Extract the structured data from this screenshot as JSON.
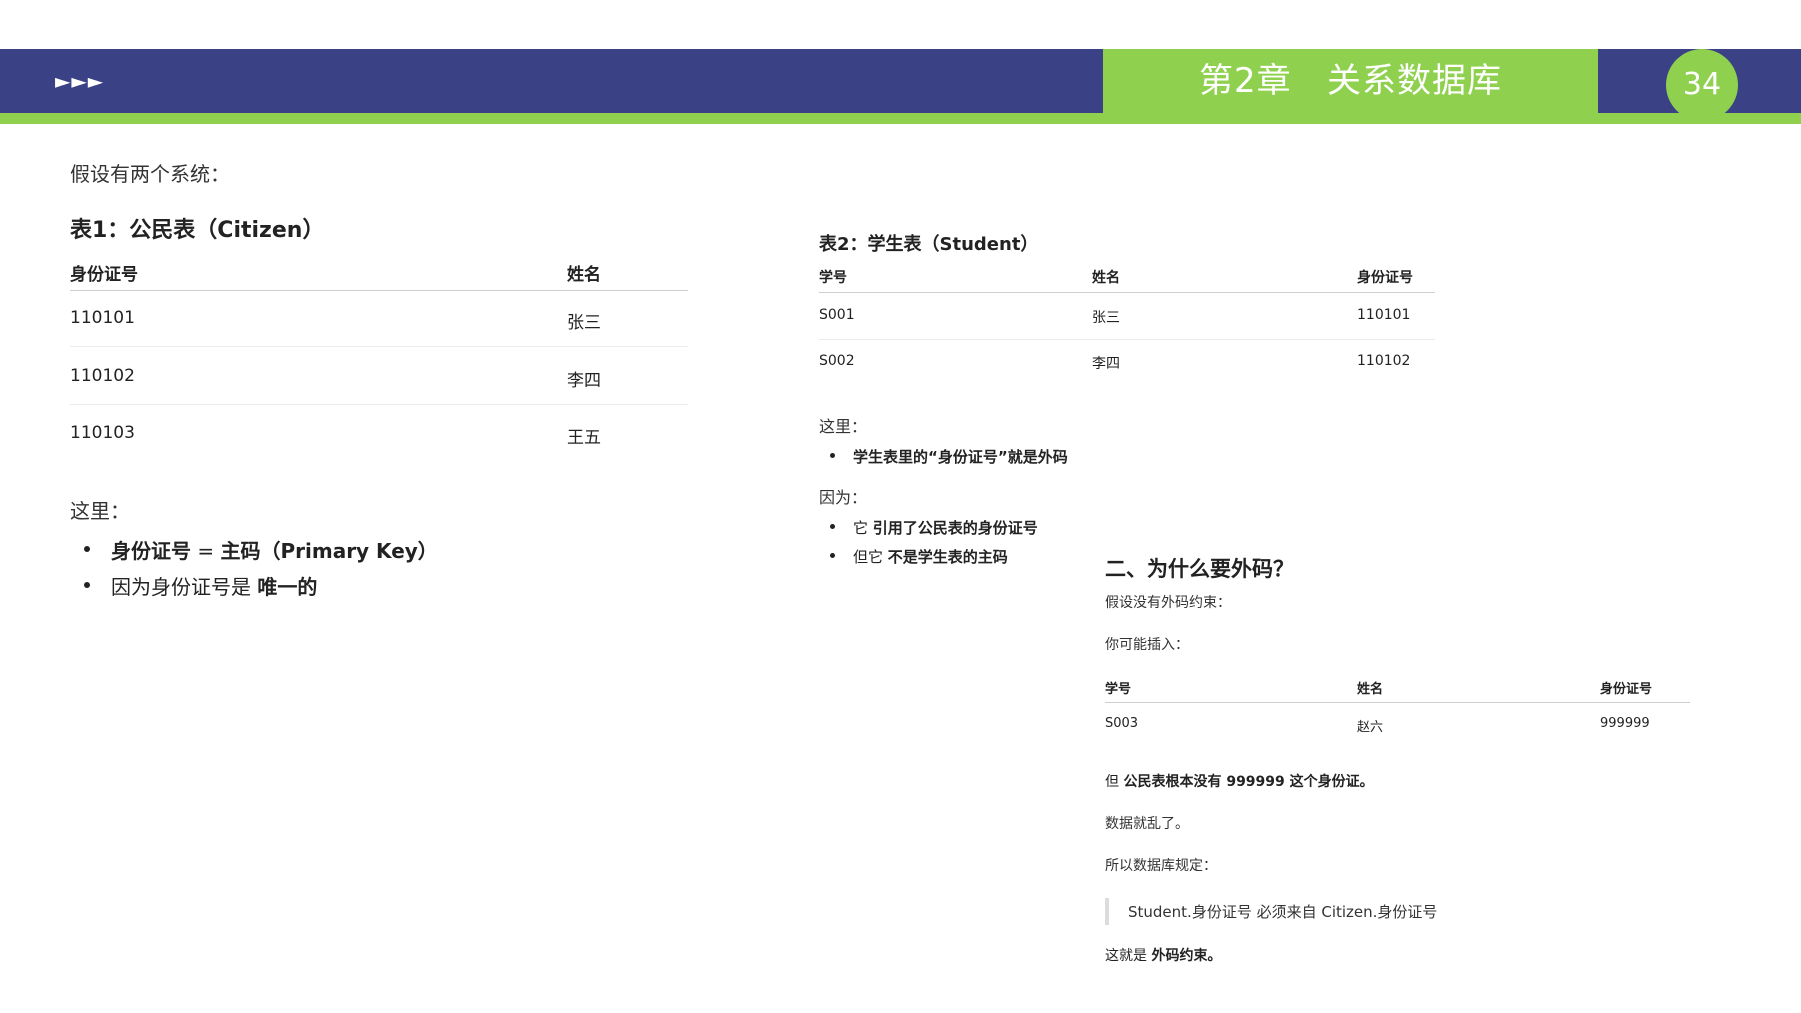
{
  "header": {
    "arrows": "►►►",
    "chapter_title": "第2章   关系数据库",
    "page_number": "34"
  },
  "left": {
    "intro": "假设有两个系统：",
    "table_title": "表1：公民表（Citizen）",
    "columns": [
      "身份证号",
      "姓名"
    ],
    "rows": [
      [
        "110101",
        "张三"
      ],
      [
        "110102",
        "李四"
      ],
      [
        "110103",
        "王五"
      ]
    ],
    "here_label": "这里：",
    "bullet1": {
      "term": "身份证号",
      "eq": " = ",
      "value": "主码（Primary Key）"
    },
    "bullet2": {
      "prefix": "因为身份证号是 ",
      "bold": "唯一的"
    }
  },
  "middle": {
    "table_title": "表2：学生表（Student）",
    "columns": [
      "学号",
      "姓名",
      "身份证号"
    ],
    "rows": [
      [
        "S001",
        "张三",
        "110101"
      ],
      [
        "S002",
        "李四",
        "110102"
      ]
    ],
    "here_label": "这里：",
    "bullet1": "学生表里的“身份证号”就是外码",
    "because_label": "因为：",
    "bullet2": {
      "prefix": "它 ",
      "bold": "引用了公民表的身份证号"
    },
    "bullet3": {
      "prefix": "但它 ",
      "bold": "不是学生表的主码"
    }
  },
  "right": {
    "heading": "二、为什么要外码？",
    "line1": "假设没有外码约束：",
    "line2": "你可能插入：",
    "columns": [
      "学号",
      "姓名",
      "身份证号"
    ],
    "row": [
      "S003",
      "赵六",
      "999999"
    ],
    "warning": {
      "prefix": "但 ",
      "bold": "公民表根本没有 999999 这个身份证。"
    },
    "line3": "数据就乱了。",
    "line4": "所以数据库规定：",
    "quote": "Student.身份证号 必须来自 Citizen.身份证号",
    "conclusion": {
      "prefix": "这就是 ",
      "bold": "外码约束。"
    }
  },
  "colors": {
    "banner": "#3b4185",
    "accent_green": "#8fd14f",
    "text": "#222222"
  }
}
